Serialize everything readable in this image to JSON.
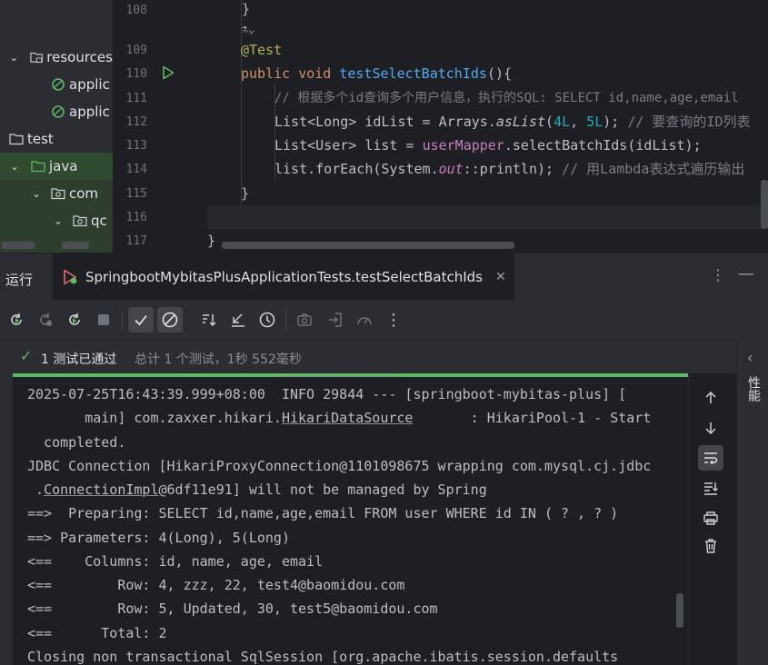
{
  "project_tree": {
    "items": [
      {
        "label": "resources",
        "icon": "resources-folder-icon",
        "chevron": "down"
      },
      {
        "label": "applic",
        "icon": "spring-config-icon"
      },
      {
        "label": "applic",
        "icon": "spring-config-icon"
      },
      {
        "label": "test",
        "icon": "folder-icon"
      },
      {
        "label": "java",
        "icon": "test-source-folder-icon",
        "chevron": "down"
      },
      {
        "label": "com",
        "icon": "package-icon",
        "chevron": "down"
      },
      {
        "label": "qc",
        "icon": "package-icon",
        "chevron": "down"
      }
    ]
  },
  "editor": {
    "line_numbers": [
      "108",
      "",
      "109",
      "110",
      "111",
      "112",
      "113",
      "114",
      "115",
      "116",
      "117"
    ],
    "inlay_hint": "⚗⌄",
    "code": {
      "l108": "}",
      "l109_annotation": "@Test",
      "l110_public": "public",
      "l110_void": "void",
      "l110_method": "testSelectBatchIds",
      "l110_rest": "(){",
      "l111_comment": "// 根据多个id查询多个用户信息，执行的SQL: SELECT id,name,age,email",
      "l112_a": "List<Long> idList = Arrays.",
      "l112_b": "asList",
      "l112_c": "(",
      "l112_n1": "4L",
      "l112_d": ", ",
      "l112_n2": "5L",
      "l112_e": "); ",
      "l112_comment": "// 要查询的ID列表",
      "l113_a": "List<User> list = ",
      "l113_b": "userMapper",
      "l113_c": ".selectBatchIds(idList);",
      "l114_a": "list.forEach(System.",
      "l114_b": "out",
      "l114_c": "::println); ",
      "l114_comment": "// 用Lambda表达式遍历输出",
      "l115": "}",
      "l117": "}"
    }
  },
  "run_window": {
    "title": "运行",
    "tab_label": "SpringbootMybitasPlusApplicationTests.testSelectBatchIds",
    "status_passed": "1 测试已通过",
    "status_total": "总计 1 个测试，1秒 552毫秒",
    "side_label": "性能"
  },
  "console": {
    "lines": [
      "2025-07-25T16:43:39.999+08:00  INFO 29844 --- [springboot-mybitas-plus] [",
      "       main] com.zaxxer.hikari.",
      "HikariDataSource",
      "       : HikariPool-1 - Start",
      "  completed.",
      "JDBC Connection [HikariProxyConnection@1101098675 wrapping com.mysql.cj.jdbc",
      " .",
      "ConnectionImpl",
      "@6df11e91] will not be managed by Spring",
      "==>  Preparing: SELECT id,name,age,email FROM user WHERE id IN ( ? , ? )",
      "==> Parameters: 4(Long), 5(Long)",
      "<==    Columns: id, name, age, email",
      "<==        Row: 4, zzz, 22, test4@baomidou.com",
      "<==        Row: 5, Updated, 30, test5@baomidou.com",
      "<==      Total: 2",
      "Closing non transactional SqlSession [org.apache.ibatis.session.defaults"
    ]
  },
  "colors": {
    "accent": "#3574f0",
    "success": "#5fb865",
    "keyword": "#cf8e6d",
    "method": "#56a8f5",
    "annotation": "#b3ae60",
    "comment": "#7a7e85"
  }
}
